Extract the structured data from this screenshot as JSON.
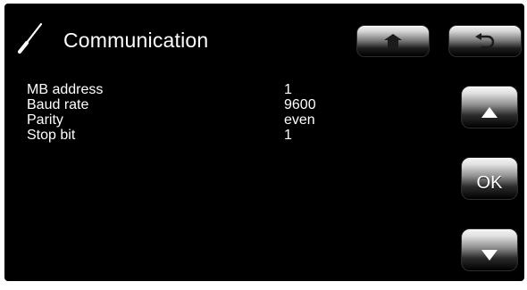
{
  "header": {
    "title": "Communication",
    "icon": "screwdriver-icon"
  },
  "top_buttons": [
    {
      "name": "home",
      "icon": "home-icon"
    },
    {
      "name": "back",
      "icon": "undo-arrow-icon"
    }
  ],
  "parameters": [
    {
      "label": "MB address",
      "value": "1"
    },
    {
      "label": "Baud rate",
      "value": "9600"
    },
    {
      "label": "Parity",
      "value": "even"
    },
    {
      "label": "Stop bit",
      "value": "1"
    }
  ],
  "side_buttons": {
    "up_icon": "triangle-up-icon",
    "ok_label": "OK",
    "down_icon": "triangle-down-icon"
  },
  "colors": {
    "screen_background": "#000000",
    "text": "#ffffff",
    "button_highlight": "#f1f1f1",
    "button_shadow": "#000000"
  }
}
